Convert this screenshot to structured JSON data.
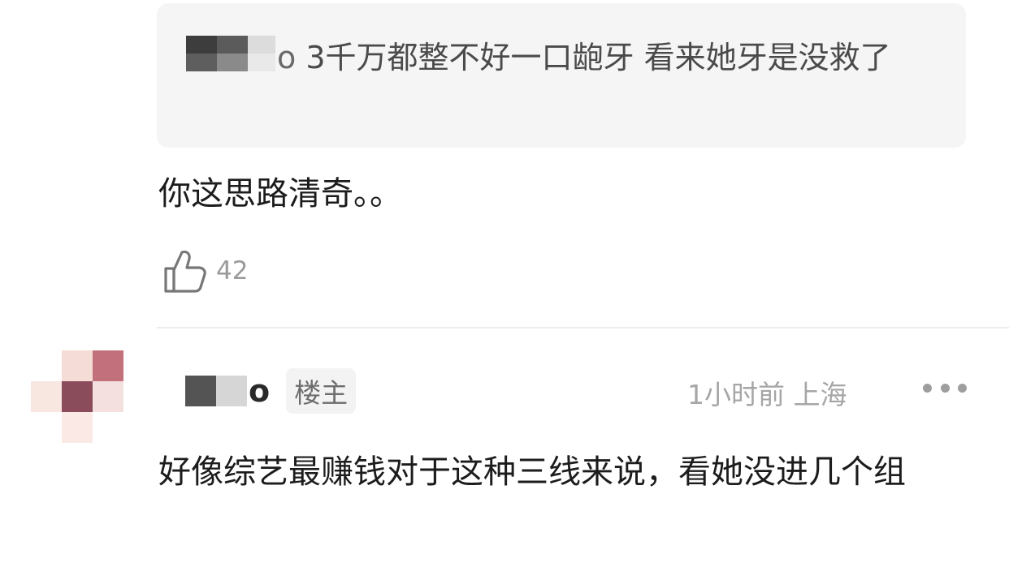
{
  "quote": {
    "author_suffix": "o",
    "text": "3千万都整不好一口龅牙 看来她牙是没救了"
  },
  "reply": {
    "text": "你这思路清奇。。",
    "like_icon": "thumbs-up-icon",
    "like_count": "42"
  },
  "comment": {
    "author_suffix": "o",
    "badge": "楼主",
    "time": "1小时前",
    "location": "上海",
    "more_icon": "more-dots-icon",
    "text": "好像综艺最赚钱对于这种三线来说，看她没进几个组"
  }
}
